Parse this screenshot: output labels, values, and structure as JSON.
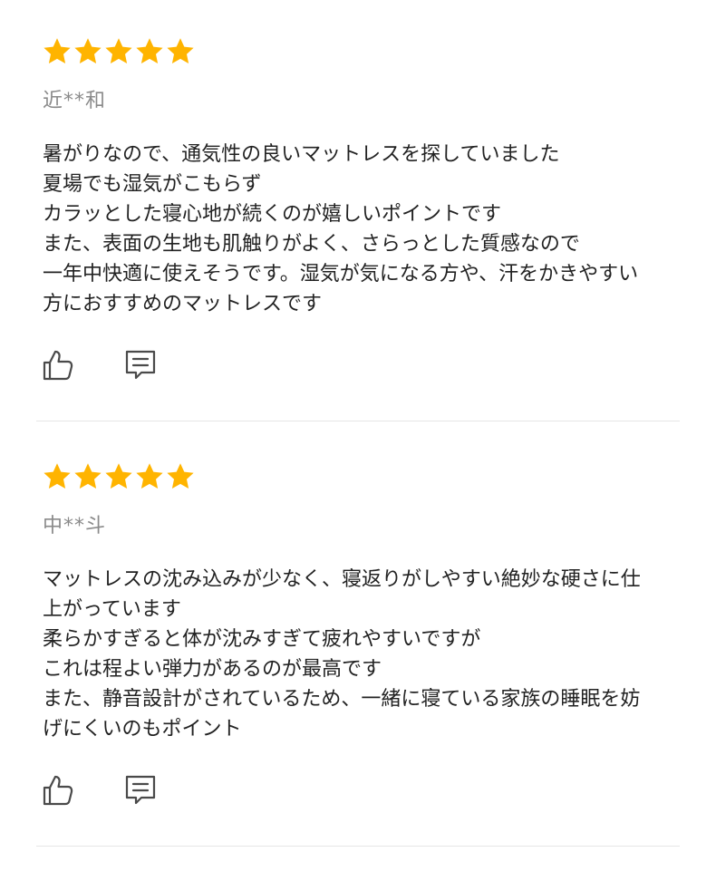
{
  "colors": {
    "star": "#FFB400",
    "text": "#222222",
    "author": "#8a8a8a",
    "icon": "#4a4a4a",
    "divider": "#e6e6e6"
  },
  "reviews": [
    {
      "rating": 5,
      "author": "近**和",
      "lines": [
        "暑がりなので、通気性の良いマットレスを探していました",
        "夏場でも湿気がこもらず",
        "カラッとした寝心地が続くのが嬉しいポイントです",
        "また、表面の生地も肌触りがよく、さらっとした質感なので",
        "一年中快適に使えそうです。湿気が気になる方や、汗をかきやすい",
        "方におすすめのマットレスです"
      ],
      "actions": {
        "like_icon": "thumbs-up-icon",
        "comment_icon": "comment-icon"
      }
    },
    {
      "rating": 5,
      "author": "中**斗",
      "lines": [
        "マットレスの沈み込みが少なく、寝返りがしやすい絶妙な硬さに仕",
        "上がっています",
        "柔らかすぎると体が沈みすぎて疲れやすいですが",
        "これは程よい弾力があるのが最高です",
        "また、静音設計がされているため、一緒に寝ている家族の睡眠を妨",
        "げにくいのもポイント"
      ],
      "actions": {
        "like_icon": "thumbs-up-icon",
        "comment_icon": "comment-icon"
      }
    }
  ]
}
